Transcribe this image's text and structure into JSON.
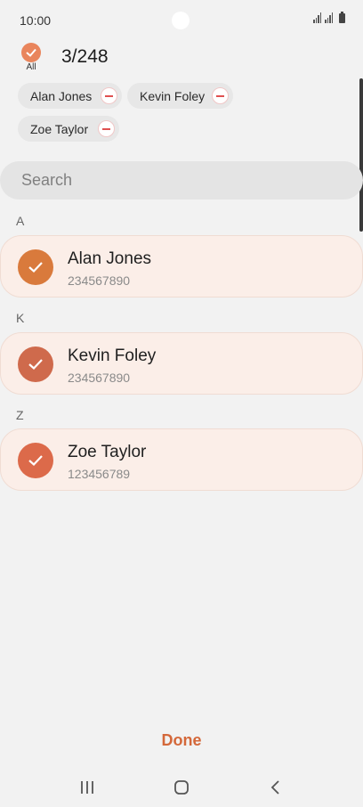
{
  "status": {
    "time": "10:00"
  },
  "header": {
    "all_label": "All",
    "count": "3/248"
  },
  "chips": [
    {
      "label": "Alan Jones"
    },
    {
      "label": "Kevin Foley"
    },
    {
      "label": "Zoe Taylor"
    }
  ],
  "search": {
    "placeholder": "Search"
  },
  "sections": [
    {
      "letter": "A",
      "contact": {
        "name": "Alan Jones",
        "number": "234567890"
      }
    },
    {
      "letter": "K",
      "contact": {
        "name": "Kevin Foley",
        "number": "234567890"
      }
    },
    {
      "letter": "Z",
      "contact": {
        "name": "Zoe Taylor",
        "number": "123456789"
      }
    }
  ],
  "footer": {
    "done_label": "Done"
  },
  "colors": {
    "accent": "#d4683a",
    "check_a": "#d97a3c",
    "check_k": "#cf6a4c",
    "check_z": "#dc6a4a",
    "card_bg": "#fbeee8"
  },
  "icons": {
    "select_all": "check-circle-icon",
    "remove_chip": "minus-circle-icon",
    "nav_recent": "recent-apps-icon",
    "nav_home": "home-icon",
    "nav_back": "back-icon"
  }
}
